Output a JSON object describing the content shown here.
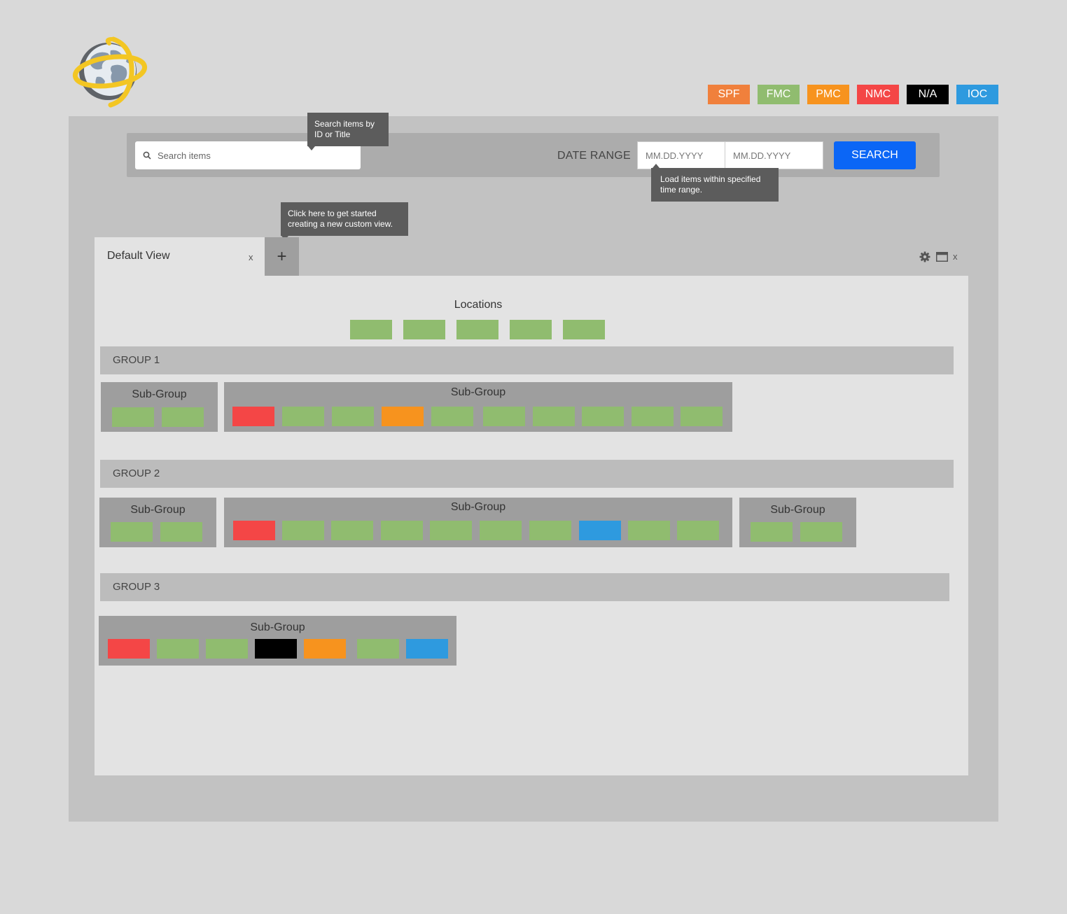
{
  "colors": {
    "green": "#90bc6f",
    "red": "#f44646",
    "orange": "#f7931e",
    "black": "#000000",
    "blue": "#2e9adf",
    "spf": "#f0803c",
    "fmc": "#90bc6f",
    "pmc": "#f7931e",
    "nmc": "#f44646",
    "na": "#000000",
    "ioc": "#2e9adf",
    "accent": "#0b66f6"
  },
  "logo": {
    "icon": "globe-with-orbit"
  },
  "legend": [
    {
      "label": "SPF",
      "color": "#f0803c"
    },
    {
      "label": "FMC",
      "color": "#90bc6f"
    },
    {
      "label": "PMC",
      "color": "#f7931e"
    },
    {
      "label": "NMC",
      "color": "#f44646"
    },
    {
      "label": "N/A",
      "color": "#000000"
    },
    {
      "label": "IOC",
      "color": "#2e9adf"
    }
  ],
  "search": {
    "placeholder": "Search items",
    "tooltip": "Search items by ID or Title",
    "date_range_label": "DATE RANGE",
    "date_start_placeholder": "MM.DD.YYYY",
    "date_end_placeholder": "MM.DD.YYYY",
    "date_tooltip": "Load items within specified time range.",
    "button_label": "SEARCH"
  },
  "tabs": {
    "items": [
      {
        "label": "Default View",
        "close": "x"
      }
    ],
    "add_label": "+",
    "add_tooltip": "Click here to get started creating a new custom view."
  },
  "panel_controls": {
    "close": "x"
  },
  "locations": {
    "title": "Locations",
    "cells": [
      "green",
      "green",
      "green",
      "green",
      "green"
    ]
  },
  "groups": [
    {
      "title": "GROUP 1",
      "subgroups": [
        {
          "title": "Sub-Group",
          "cells": [
            "green",
            "green"
          ]
        },
        {
          "title": "Sub-Group",
          "cells": [
            "red",
            "green",
            "green",
            "orange",
            "green",
            "green",
            "green",
            "green",
            "green",
            "green"
          ]
        }
      ]
    },
    {
      "title": "GROUP 2",
      "subgroups": [
        {
          "title": "Sub-Group",
          "cells": [
            "green",
            "green"
          ]
        },
        {
          "title": "Sub-Group",
          "cells": [
            "red",
            "green",
            "green",
            "green",
            "green",
            "green",
            "green",
            "blue",
            "green",
            "green"
          ]
        },
        {
          "title": "Sub-Group",
          "cells": [
            "green",
            "green"
          ]
        }
      ]
    },
    {
      "title": "GROUP 3",
      "subgroups": [
        {
          "title": "Sub-Group",
          "cells": [
            "red",
            "green",
            "green",
            "black",
            "orange",
            "green",
            "blue"
          ]
        }
      ]
    }
  ]
}
